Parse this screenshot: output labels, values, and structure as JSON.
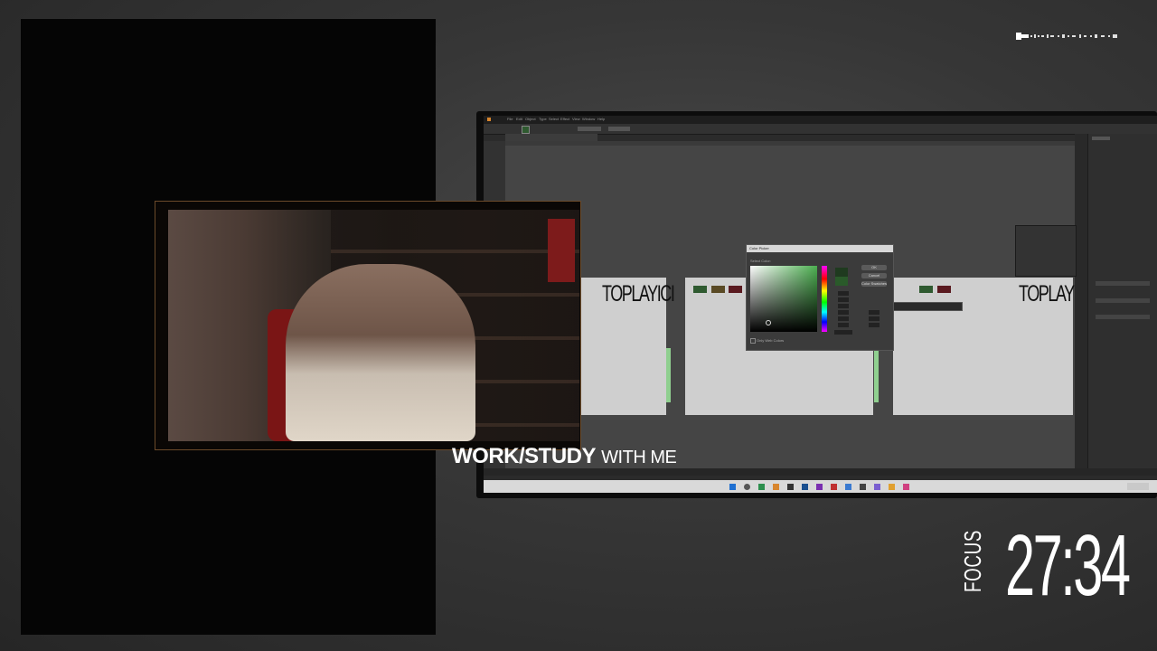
{
  "overlay": {
    "caption_bold": "WORK/STUDY",
    "caption_light": "WITH ME",
    "timer_label": "FOCUS",
    "timer_value": "27:34"
  },
  "illustrator": {
    "menu_items": [
      "File",
      "Edit",
      "Object",
      "Type",
      "Select",
      "Effect",
      "View",
      "Window",
      "Help"
    ],
    "artboard_logo_text": "TOPLAYICI",
    "swatch_colors": [
      "#2f5a30",
      "#5a4a25",
      "#5a1a20"
    ],
    "picker": {
      "title": "Color Picker",
      "select_color_label": "Select Color:",
      "ok_label": "OK",
      "cancel_label": "Cancel",
      "swatches_label": "Color Swatches",
      "web_colors_label": "Only Web Colors"
    }
  },
  "colors": {
    "accent_green": "#4caf50",
    "frame_border": "#6b4a2a"
  }
}
